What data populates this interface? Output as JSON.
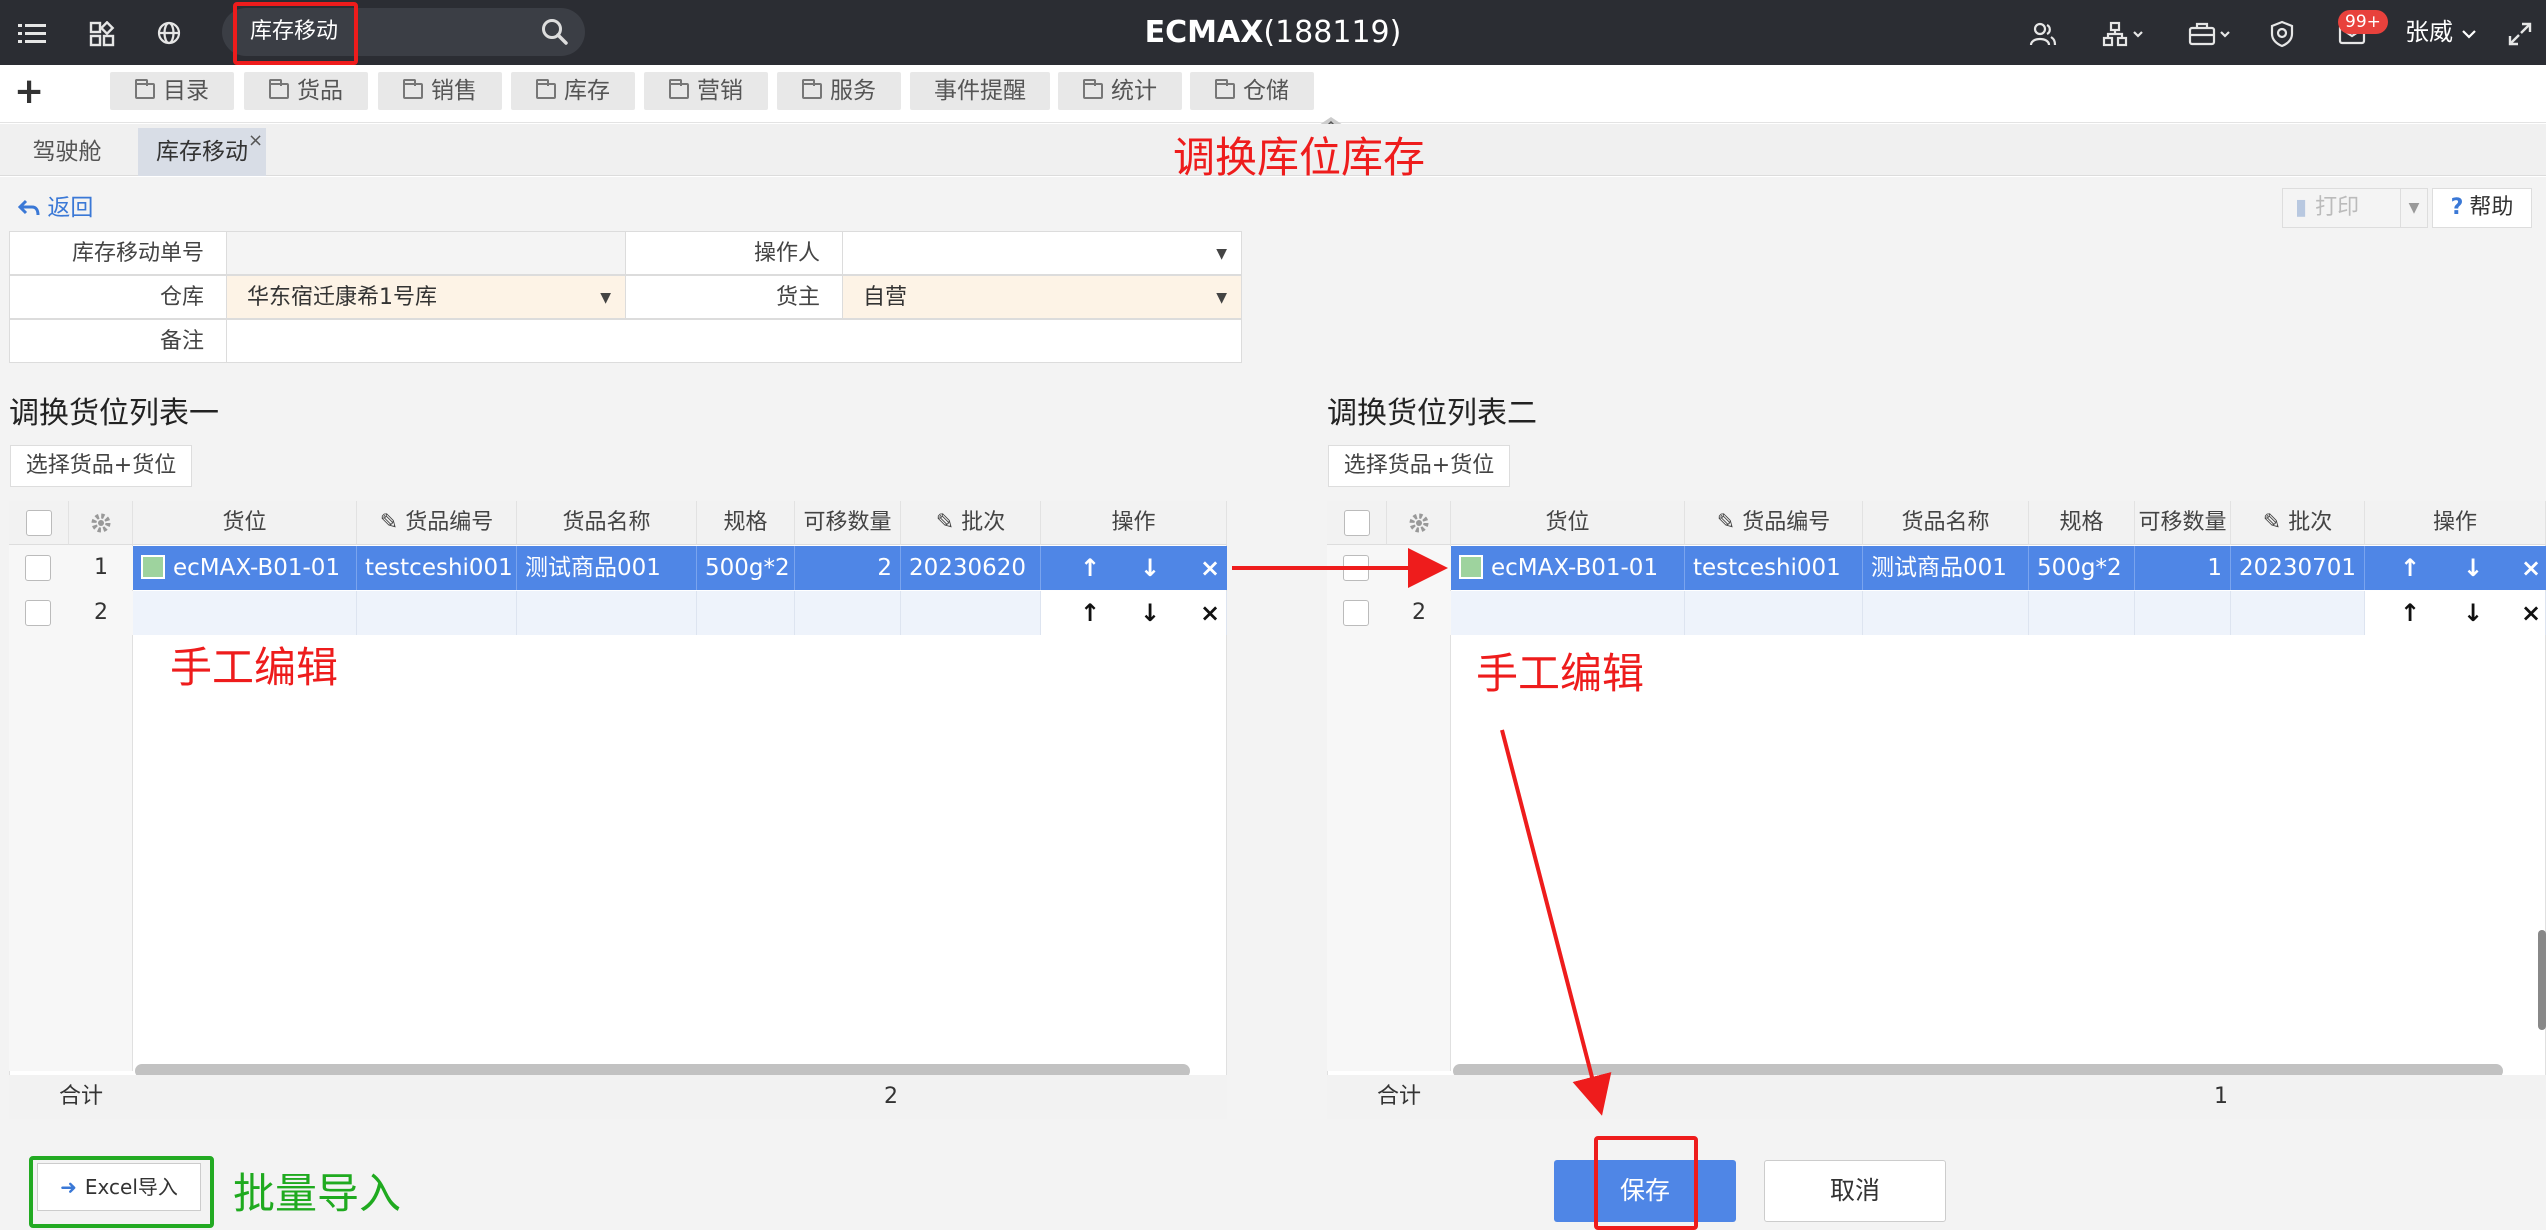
{
  "topbar": {
    "search_value": "库存移动",
    "app_title_bold": "ECMAX",
    "app_title_rest": "(188119)",
    "mail_badge": "99+",
    "user_name": "张威",
    "icons": [
      "menu-icon",
      "apps-icon",
      "globe-icon",
      "search-icon",
      "users-icon",
      "org-icon",
      "briefcase-icon",
      "support-icon",
      "mail-icon",
      "fullscreen-icon"
    ]
  },
  "menu": {
    "add": "+",
    "items": [
      "目录",
      "货品",
      "销售",
      "库存",
      "营销",
      "服务",
      "事件提醒",
      "统计",
      "仓储"
    ]
  },
  "tabs": {
    "home": "驾驶舱",
    "active": "库存移动",
    "close": "×"
  },
  "toolbar": {
    "back": "返回",
    "print": "打印",
    "help": "帮助"
  },
  "form": {
    "doc_no_label": "库存移动单号",
    "doc_no_value": "",
    "operator_label": "操作人",
    "operator_value": "",
    "warehouse_label": "仓库",
    "warehouse_value": "华东宿迁康希1号库",
    "owner_label": "货主",
    "owner_value": "自营",
    "remark_label": "备注",
    "remark_value": ""
  },
  "list1": {
    "title": "调换货位列表一",
    "pick_button": "选择货品+货位",
    "columns": [
      "货位",
      "货品编号",
      "货品名称",
      "规格",
      "可移数量",
      "批次",
      "操作"
    ],
    "rows": [
      {
        "num": "1",
        "location": "ecMAX-B01-01",
        "sku": "testceshi001",
        "name": "测试商品001",
        "spec": "500g*2",
        "qty": "2",
        "batch": "20230620"
      },
      {
        "num": "2"
      }
    ],
    "footer_label": "合计",
    "footer_total": "2"
  },
  "list2": {
    "title": "调换货位列表二",
    "pick_button": "选择货品+货位",
    "columns": [
      "货位",
      "货品编号",
      "货品名称",
      "规格",
      "可移数量",
      "批次",
      "操作"
    ],
    "rows": [
      {
        "num": "1",
        "location": "ecMAX-B01-01",
        "sku": "testceshi001",
        "name": "测试商品001",
        "spec": "500g*2",
        "qty": "1",
        "batch": "20230701"
      },
      {
        "num": "2"
      }
    ],
    "footer_label": "合计",
    "footer_total": "1"
  },
  "actions": {
    "up": "↑",
    "down": "↓",
    "delete": "×"
  },
  "bottom": {
    "excel_import": "Excel导入",
    "save": "保存",
    "cancel": "取消"
  },
  "annotations": {
    "title": "调换库位库存",
    "manual_edit_1": "手工编辑",
    "manual_edit_2": "手工编辑",
    "batch_import": "批量导入"
  },
  "colors": {
    "topbar": "#2b2d33",
    "accent": "#4f86e6",
    "annotation_red": "#ee1c1c",
    "annotation_green": "#22aa22"
  }
}
